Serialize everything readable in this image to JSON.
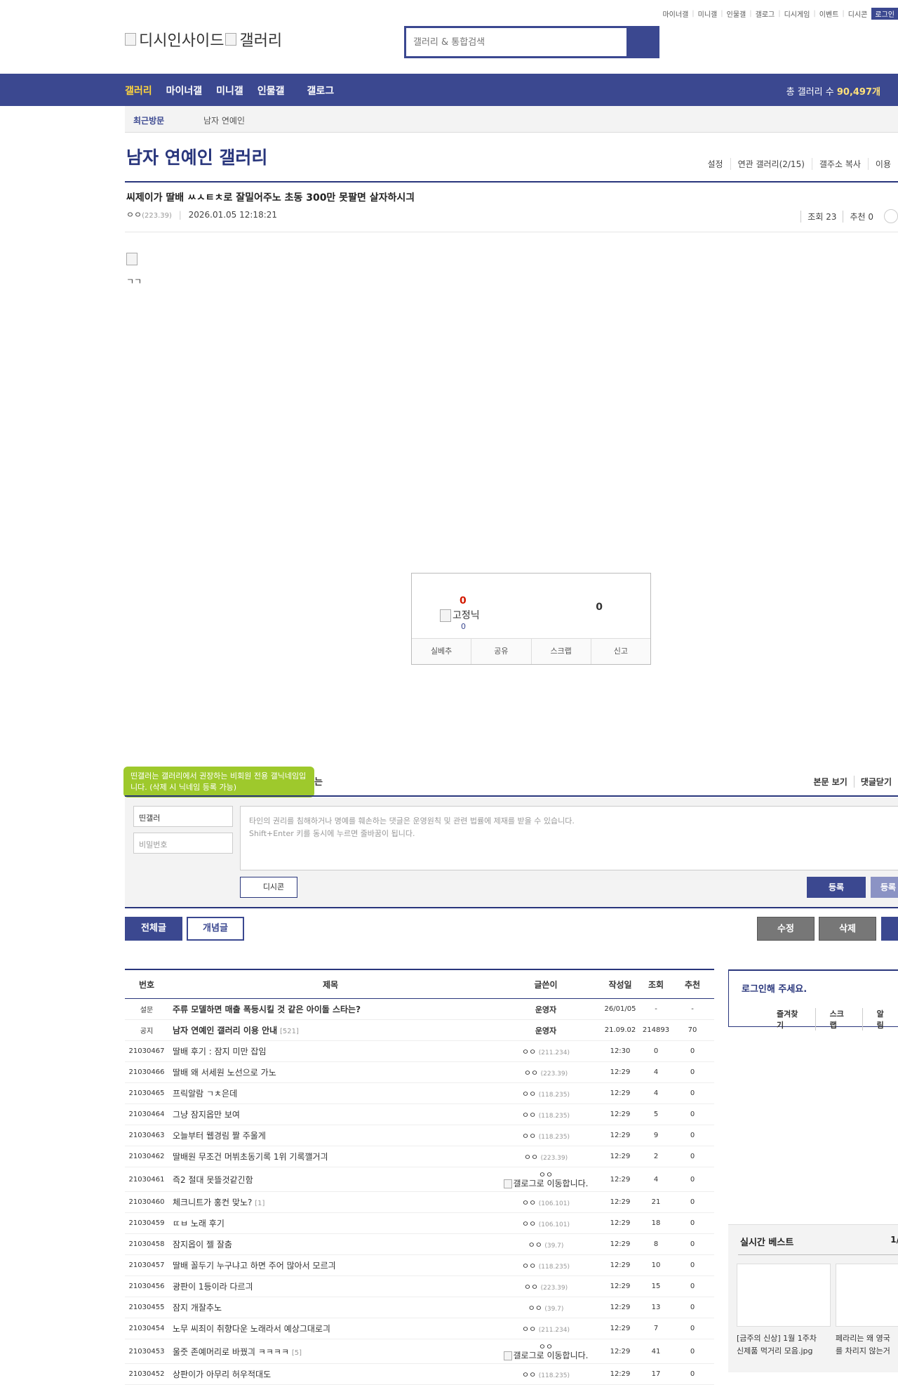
{
  "topmenu": [
    "마이너갤",
    "미니갤",
    "인물갤",
    "갤로그",
    "디시게임",
    "이벤트",
    "디시콘"
  ],
  "login_label": "로그인",
  "logo": {
    "left": "디시인사이드",
    "right": "갤러리"
  },
  "search": {
    "placeholder": "갤러리 & 통합검색"
  },
  "gnb": {
    "items": [
      "갤러리",
      "마이너갤",
      "미니갤",
      "인물갤",
      "갤로그"
    ],
    "count_label": "총 갤러리 수",
    "count_value": "90,497개"
  },
  "visit": {
    "label": "최근방문",
    "item": "남자 연예인"
  },
  "gallery": {
    "title": "남자 연예인 갤러리",
    "options": [
      "설정",
      "연관 갤러리(2/15)",
      "갤주소 복사",
      "이용"
    ]
  },
  "post": {
    "title": "씨제이가 딸배 ㅆㅅㅌㅊ로 잘밀어주노 초동 300만 못팔면 살자하시긔",
    "writer": "ㅇㅇ",
    "ip": "(223.39)",
    "datetime": "2026.01.05 12:18:21",
    "views": "조회 23",
    "recommends": "추천 0",
    "body": "ㄱㄱ"
  },
  "recommend": {
    "up": "0",
    "fixed_label": "고정닉",
    "fixed_count": "0",
    "down": "0",
    "buttons": [
      "실베추",
      "공유",
      "스크랩",
      "신고"
    ]
  },
  "comment": {
    "tooltip": "띤갤러는 갤러리에서 권장하는 비회원 전용 갤닉네임입니다. (삭제 시 닉네임 등록 가능)",
    "heading_tail": "는",
    "right_links": [
      "본문 보기",
      "댓글닫기"
    ],
    "nick_value": "띤갤러",
    "pw_placeholder": "비밀번호",
    "textarea_line1": "타인의 권리를 침해하거나 명예를 훼손하는 댓글은 운영원칙 및 관련 법률에 제재를 받을 수 있습니다.",
    "textarea_line2": "Shift+Enter 키를 동시에 누르면 줄바꿈이 됩니다.",
    "dccon": "디시콘",
    "register": "등록",
    "register2": "등록"
  },
  "list_tabs": {
    "all": "전체글",
    "recommended": "개념글"
  },
  "actions": {
    "edit": "수정",
    "delete": "삭제"
  },
  "list": {
    "headers": [
      "번호",
      "제목",
      "글쓴이",
      "작성일",
      "조회",
      "추천"
    ],
    "rows": [
      {
        "num": "설문",
        "subj": "주류 모델하면 매출 폭등시킬 것 같은 아이돌 스타는?",
        "reply": "",
        "writer": "운영자",
        "ip": "",
        "date": "26/01/05",
        "view": "-",
        "rec": "-"
      },
      {
        "num": "공지",
        "subj": "남자 연예인 갤러리 이용 안내",
        "reply": "[521]",
        "writer": "운영자",
        "ip": "",
        "date": "21.09.02",
        "view": "214893",
        "rec": "70"
      },
      {
        "num": "21030467",
        "subj": "딸배 후기 : 잠지 미만 잡임",
        "reply": "",
        "writer": "ㅇㅇ",
        "ip": "(211.234)",
        "date": "12:30",
        "view": "0",
        "rec": "0"
      },
      {
        "num": "21030466",
        "subj": "딸배 왜 서세원 노선으로 가노",
        "reply": "",
        "writer": "ㅇㅇ",
        "ip": "(223.39)",
        "date": "12:29",
        "view": "4",
        "rec": "0"
      },
      {
        "num": "21030465",
        "subj": "프릭알람 ㄱㅊ은데",
        "reply": "",
        "writer": "ㅇㅇ",
        "ip": "(118.235)",
        "date": "12:29",
        "view": "4",
        "rec": "0"
      },
      {
        "num": "21030464",
        "subj": "그냥 잠지옵만 보여",
        "reply": "",
        "writer": "ㅇㅇ",
        "ip": "(118.235)",
        "date": "12:29",
        "view": "5",
        "rec": "0"
      },
      {
        "num": "21030463",
        "subj": "오늘부터 웹경림 짤 주울게",
        "reply": "",
        "writer": "ㅇㅇ",
        "ip": "(118.235)",
        "date": "12:29",
        "view": "9",
        "rec": "0"
      },
      {
        "num": "21030462",
        "subj": "딸배원 무조건 머뷔초동기록 1위 기록깰거긔",
        "reply": "",
        "writer": "ㅇㅇ",
        "ip": "(223.39)",
        "date": "12:29",
        "view": "2",
        "rec": "0"
      },
      {
        "num": "21030461",
        "subj": "즉2 절대 못뜰것같긴함",
        "reply": "",
        "writer": "ㅇㅇ",
        "ip": "",
        "gallog": "갤로그로 이동합니다.",
        "date": "12:29",
        "view": "4",
        "rec": "0"
      },
      {
        "num": "21030460",
        "subj": "체크니트가 홍컨 맞노?",
        "reply": "[1]",
        "writer": "ㅇㅇ",
        "ip": "(106.101)",
        "date": "12:29",
        "view": "21",
        "rec": "0"
      },
      {
        "num": "21030459",
        "subj": "ㄸㅂ 노래 후기",
        "reply": "",
        "writer": "ㅇㅇ",
        "ip": "(106.101)",
        "date": "12:29",
        "view": "18",
        "rec": "0"
      },
      {
        "num": "21030458",
        "subj": "잠지옵이 젤 잘춤",
        "reply": "",
        "writer": "ㅇㅇ",
        "ip": "(39.7)",
        "date": "12:29",
        "view": "8",
        "rec": "0"
      },
      {
        "num": "21030457",
        "subj": "딸배 꼴두기 누구냐고 하면 주어 많아서 모르긔",
        "reply": "",
        "writer": "ㅇㅇ",
        "ip": "(118.235)",
        "date": "12:29",
        "view": "10",
        "rec": "0"
      },
      {
        "num": "21030456",
        "subj": "광판이 1등이라 다르긔",
        "reply": "",
        "writer": "ㅇㅇ",
        "ip": "(223.39)",
        "date": "12:29",
        "view": "15",
        "rec": "0"
      },
      {
        "num": "21030455",
        "subj": "잠지 개잘추노",
        "reply": "",
        "writer": "ㅇㅇ",
        "ip": "(39.7)",
        "date": "12:29",
        "view": "13",
        "rec": "0"
      },
      {
        "num": "21030454",
        "subj": "노무 씨죄이 취향다운 노래라서 예상그대로긔",
        "reply": "",
        "writer": "ㅇㅇ",
        "ip": "(211.234)",
        "date": "12:29",
        "view": "7",
        "rec": "0"
      },
      {
        "num": "21030453",
        "subj": "울줏 존예머리로 바꿨긔 ㅋㅋㅋㅋ",
        "reply": "[5]",
        "writer": "ㅇㅇ",
        "ip": "",
        "gallog": "갤로그로 이동합니다.",
        "date": "12:29",
        "view": "41",
        "rec": "0"
      },
      {
        "num": "21030452",
        "subj": "상판이가 아무리 허우적대도",
        "reply": "",
        "writer": "ㅇㅇ",
        "ip": "(118.235)",
        "date": "12:29",
        "view": "17",
        "rec": "0"
      }
    ]
  },
  "sidebar": {
    "login_title": "로그인해 주세요.",
    "links": [
      "즐겨찾기",
      "스크랩",
      "알림"
    ],
    "best_title": "실시간 베스트",
    "best_page": "1/",
    "best_items": [
      {
        "line1": "[금주의 신상] 1월 1주차",
        "line2": "신제품 먹거리 모음.jpg"
      },
      {
        "line1": "페라리는 왜 영국",
        "line2": "를 차리지 않는거"
      }
    ]
  }
}
